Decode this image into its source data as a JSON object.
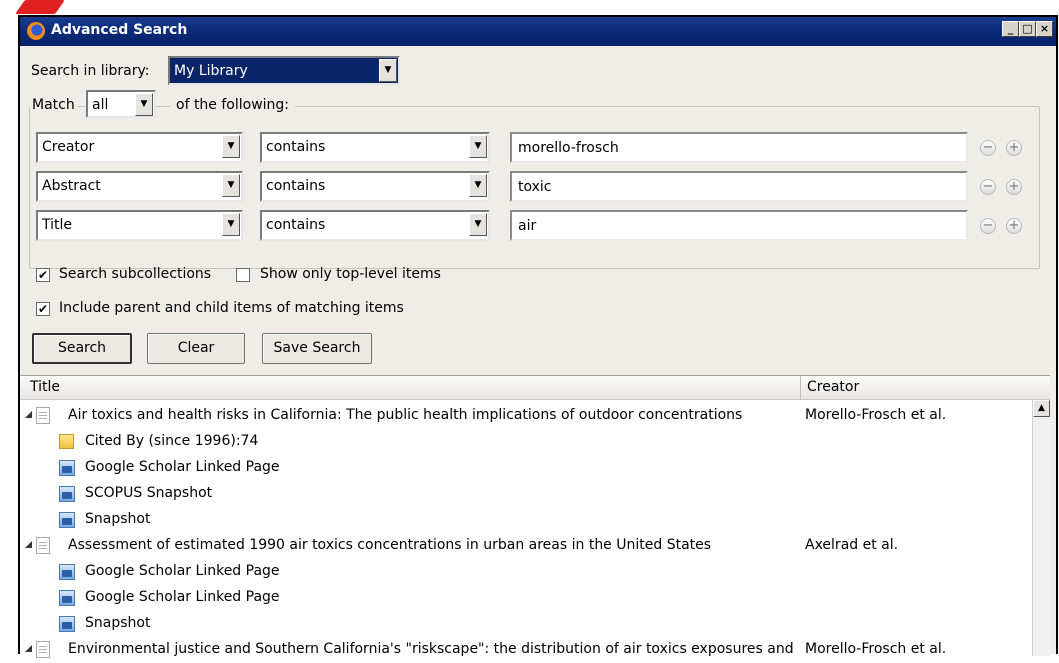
{
  "window": {
    "title": "Advanced Search",
    "controls": {
      "minimize": "_",
      "maximize": "□",
      "close": "×"
    }
  },
  "search_in": {
    "label": "Search in library:",
    "value": "My Library"
  },
  "match": {
    "prefix": "Match",
    "value": "all",
    "suffix": "of the following:"
  },
  "conditions": [
    {
      "field": "Creator",
      "operator": "contains",
      "value": "morello-frosch"
    },
    {
      "field": "Abstract",
      "operator": "contains",
      "value": "toxic"
    },
    {
      "field": "Title",
      "operator": "contains",
      "value": "air"
    }
  ],
  "condition_buttons": {
    "remove": "−",
    "add": "+"
  },
  "options": {
    "search_subcollections": {
      "label": "Search subcollections",
      "checked": true
    },
    "top_level_only": {
      "label": "Show only top-level items",
      "checked": false
    },
    "include_parent_child": {
      "label": "Include parent and child items of matching items",
      "checked": true
    }
  },
  "buttons": {
    "search": "Search",
    "clear": "Clear",
    "save_search": "Save Search"
  },
  "results": {
    "columns": [
      "Title",
      "Creator"
    ],
    "rows": [
      {
        "type": "parent",
        "title": "Air toxics and health risks in California: The public health implications of outdoor concentrations",
        "creator": "Morello-Frosch et al."
      },
      {
        "type": "note",
        "title": "Cited By (since 1996):74"
      },
      {
        "type": "attachment",
        "title": "Google Scholar Linked Page"
      },
      {
        "type": "attachment",
        "title": "SCOPUS Snapshot"
      },
      {
        "type": "attachment",
        "title": "Snapshot"
      },
      {
        "type": "parent",
        "title": "Assessment of estimated 1990 air toxics concentrations in urban areas in the United States",
        "creator": "Axelrad et al."
      },
      {
        "type": "attachment",
        "title": "Google Scholar Linked Page"
      },
      {
        "type": "attachment",
        "title": "Google Scholar Linked Page"
      },
      {
        "type": "attachment",
        "title": "Snapshot"
      },
      {
        "type": "parent",
        "title": "Environmental justice and Southern California's \"riskscape\": the distribution of air toxics exposures and",
        "creator": "Morello-Frosch et al."
      }
    ],
    "scroll_up": "▲"
  },
  "icons": {
    "dropdown": "▼",
    "checkmark": "✔",
    "expand": "expanded-twisty-icon",
    "document": "document-icon",
    "note": "note-icon",
    "snapshot": "snapshot-icon"
  }
}
